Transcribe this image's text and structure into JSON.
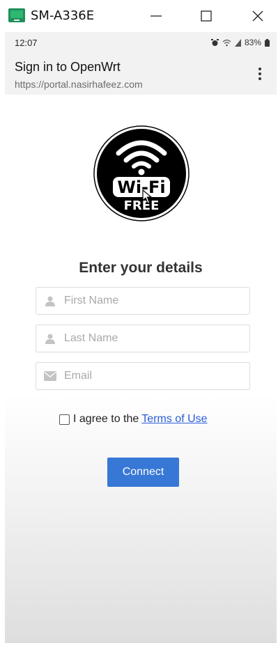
{
  "window": {
    "title": "SM-A336E",
    "minimize_glyph": "—",
    "maximize_glyph": "☐",
    "close_glyph": "✕"
  },
  "status_bar": {
    "time": "12:07",
    "battery": "83%"
  },
  "app_bar": {
    "title": "Sign in to OpenWrt",
    "url": "https://portal.nasirhafeez.com"
  },
  "logo": {
    "line1": "Wi-Fi",
    "line2": "FREE"
  },
  "form": {
    "heading": "Enter your details",
    "first_name_placeholder": "First Name",
    "last_name_placeholder": "Last Name",
    "email_placeholder": "Email",
    "agree_text": "I agree to the",
    "terms_link": "Terms of Use",
    "connect_label": "Connect"
  },
  "colors": {
    "accent": "#3777d6",
    "link": "#2a5bd7",
    "app_icon": "#1f8f5a"
  },
  "icons": [
    "app-icon",
    "minimize-icon",
    "maximize-icon",
    "close-icon",
    "alarm-icon",
    "wifi-icon",
    "signal-icon",
    "battery-icon",
    "more-vert-icon",
    "user-icon",
    "email-icon",
    "mouse-cursor-icon"
  ]
}
